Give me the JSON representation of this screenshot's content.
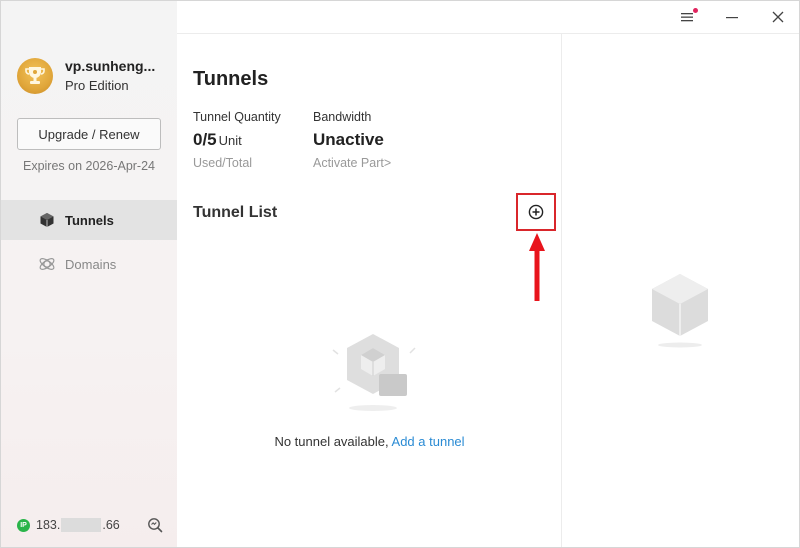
{
  "window": {
    "controls": {
      "menu_icon": "hamburger-menu-icon",
      "minimize_icon": "minimize-icon",
      "close_icon": "close-icon",
      "notification_color": "#e0245e"
    }
  },
  "sidebar": {
    "username": "vp.sunheng...",
    "edition": "Pro Edition",
    "upgrade_label": "Upgrade / Renew",
    "expires": "Expires on 2026-Apr-24",
    "nav": [
      {
        "label": "Tunnels",
        "icon": "cube-icon",
        "active": true
      },
      {
        "label": "Domains",
        "icon": "globe-orbit-icon",
        "active": false
      }
    ],
    "ip": {
      "prefix": "183.",
      "suffix": ".66",
      "badge": "IP",
      "status_color": "#2ab44a"
    }
  },
  "main": {
    "title": "Tunnels",
    "stats": {
      "quantity": {
        "label": "Tunnel Quantity",
        "value": "0/5",
        "unit": "Unit",
        "sub": "Used/Total"
      },
      "bandwidth": {
        "label": "Bandwidth",
        "value": "Unactive",
        "sub": "Activate Part>"
      }
    },
    "list_title": "Tunnel List",
    "add_icon": "plus-circle-icon",
    "empty": {
      "text": "No tunnel available, ",
      "link": "Add a tunnel"
    }
  },
  "colors": {
    "accent_link": "#2a8bd4",
    "highlight_red": "#d9262b"
  }
}
